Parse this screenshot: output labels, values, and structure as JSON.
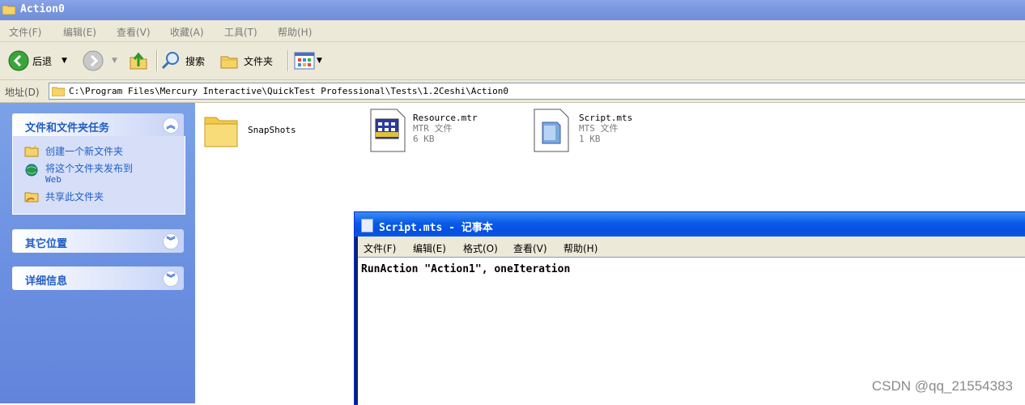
{
  "window": {
    "title": "Action0"
  },
  "menu": [
    "文件(F)",
    "编辑(E)",
    "查看(V)",
    "收藏(A)",
    "工具(T)",
    "帮助(H)"
  ],
  "toolbar": {
    "back_label": "后退",
    "search_label": "搜索",
    "folders_label": "文件夹"
  },
  "address": {
    "label": "地址(D)",
    "path": "C:\\Program Files\\Mercury Interactive\\QuickTest Professional\\Tests\\1.2Ceshi\\Action0"
  },
  "sidebar": {
    "tasks_title": "文件和文件夹任务",
    "tasks": [
      {
        "label": "创建一个新文件夹",
        "icon": "new-folder-icon"
      },
      {
        "label": "将这个文件夹发布到",
        "label2": "Web",
        "icon": "publish-web-icon"
      },
      {
        "label": "共享此文件夹",
        "icon": "share-folder-icon"
      }
    ],
    "other_title": "其它位置",
    "details_title": "详细信息"
  },
  "files": [
    {
      "name": "SnapShots",
      "type": "",
      "size": "",
      "icon": "folder-icon"
    },
    {
      "name": "Resource.mtr",
      "type": "MTR 文件",
      "size": "6 KB",
      "icon": "mtr-file-icon"
    },
    {
      "name": "Script.mts",
      "type": "MTS 文件",
      "size": "1 KB",
      "icon": "mts-file-icon"
    }
  ],
  "notepad": {
    "title": "Script.mts - 记事本",
    "menu": [
      "文件(F)",
      "编辑(E)",
      "格式(O)",
      "查看(V)",
      "帮助(H)"
    ],
    "content": "RunAction \"Action1\", oneIteration"
  },
  "watermark": "CSDN @qq_21554383",
  "colors": {
    "accent_blue": "#215dc6",
    "sidebar_bg": "#6a8ee0",
    "titlebar_active": "#0a5ae8"
  }
}
